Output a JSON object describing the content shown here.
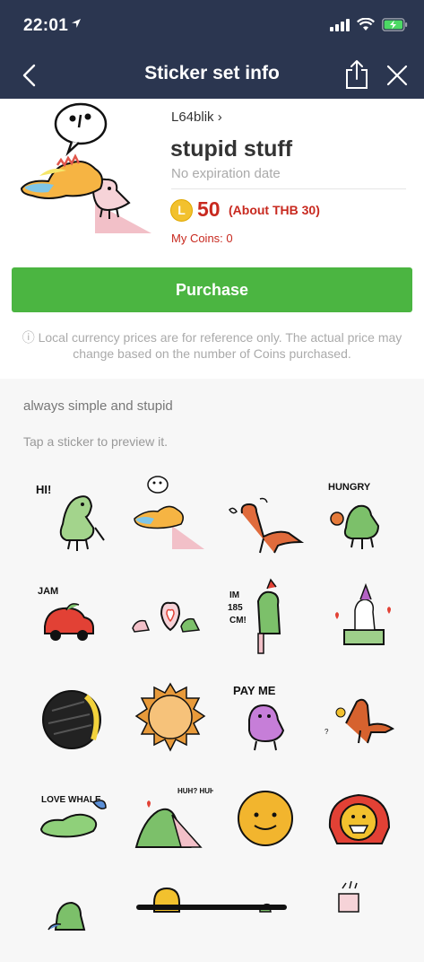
{
  "status_bar": {
    "time": "22:01"
  },
  "nav": {
    "title": "Sticker set info"
  },
  "sticker_set": {
    "author": "L64blik",
    "title": "stupid stuff",
    "expiry": "No expiration date",
    "coin_letter": "L",
    "price": "50",
    "price_local": "(About THB 30)",
    "my_coins": "My Coins: 0"
  },
  "purchase_label": "Purchase",
  "notice": "Local currency prices are for reference only. The actual price may change based on the number of Coins purchased.",
  "description": "always simple and stupid",
  "tap_hint": "Tap a sticker to preview it.",
  "sticker_texts": {
    "hi": "HI!",
    "hungry": "HUNGRY",
    "jam": "JAM",
    "height": "IM 185 CM!",
    "pay_me": "PAY ME",
    "love_whale": "LOVE WHALE",
    "huh": "HUH? HUH"
  },
  "colors": {
    "nav": "#2b3650",
    "purchase": "#4bb541",
    "price": "#c8291f",
    "coin": "#f2c12e"
  }
}
